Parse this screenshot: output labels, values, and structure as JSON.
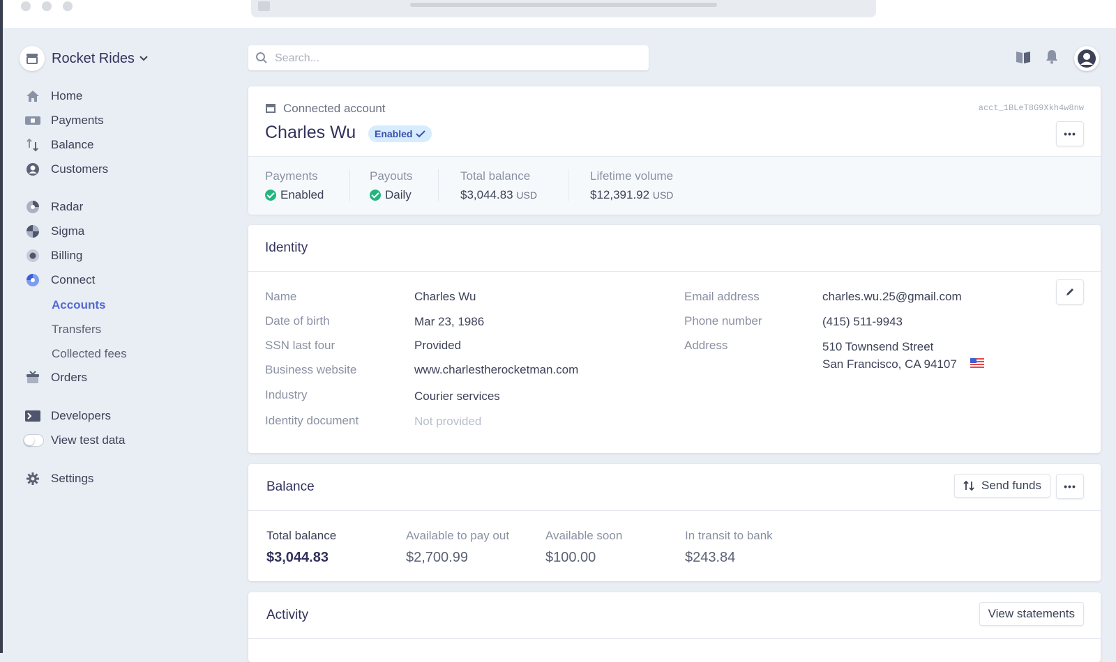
{
  "app": {
    "brand": "Rocket Rides"
  },
  "search": {
    "placeholder": "Search..."
  },
  "sidebar": {
    "items": [
      {
        "label": "Home"
      },
      {
        "label": "Payments"
      },
      {
        "label": "Balance"
      },
      {
        "label": "Customers"
      },
      {
        "label": "Radar"
      },
      {
        "label": "Sigma"
      },
      {
        "label": "Billing"
      },
      {
        "label": "Connect"
      },
      {
        "label": "Accounts"
      },
      {
        "label": "Transfers"
      },
      {
        "label": "Collected fees"
      },
      {
        "label": "Orders"
      },
      {
        "label": "Developers"
      },
      {
        "label": "View test data"
      },
      {
        "label": "Settings"
      }
    ]
  },
  "account": {
    "eyebrow": "Connected account",
    "name": "Charles Wu",
    "status_badge": "Enabled",
    "account_id": "acct_1BLeT8G9Xkh4w8nw",
    "summary": [
      {
        "label": "Payments",
        "value": "Enabled"
      },
      {
        "label": "Payouts",
        "value": "Daily"
      },
      {
        "label": "Total balance",
        "value": "$3,044.83",
        "currency": "USD"
      },
      {
        "label": "Lifetime volume",
        "value": "$12,391.92",
        "currency": "USD"
      }
    ]
  },
  "identity": {
    "title": "Identity",
    "left": [
      {
        "label": "Name",
        "value": "Charles Wu"
      },
      {
        "label": "Date of birth",
        "value": "Mar 23, 1986"
      },
      {
        "label": "SSN last four",
        "value": "Provided"
      },
      {
        "label": "Business website",
        "value": "www.charlestherocketman.com"
      },
      {
        "label": "Industry",
        "value": "Courier services"
      },
      {
        "label": "Identity document",
        "value": "Not provided"
      }
    ],
    "right": [
      {
        "label": "Email address",
        "value": "charles.wu.25@gmail.com"
      },
      {
        "label": "Phone number",
        "value": "(415) 511-9943"
      },
      {
        "label": "Address",
        "line1": "510 Townsend Street",
        "line2": "San Francisco, CA 94107"
      }
    ]
  },
  "balance": {
    "title": "Balance",
    "send_funds_label": "Send funds",
    "items": [
      {
        "label": "Total balance",
        "value": "$3,044.83"
      },
      {
        "label": "Available to pay out",
        "value": "$2,700.99"
      },
      {
        "label": "Available soon",
        "value": "$100.00"
      },
      {
        "label": "In transit to bank",
        "value": "$243.84"
      }
    ]
  },
  "activity": {
    "title": "Activity",
    "view_statements_label": "View statements"
  },
  "colors": {
    "accent": "#5469d4",
    "success": "#24b47e",
    "badge_bg": "#d6ecff",
    "badge_text": "#3d4eac"
  }
}
